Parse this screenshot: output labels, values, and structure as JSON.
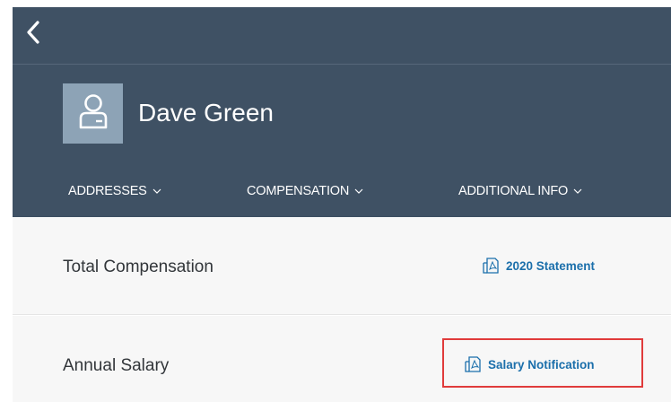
{
  "header": {
    "employee_name": "Dave Green",
    "background_color": "#3f5164",
    "tabs": [
      {
        "label": "ADDRESSES"
      },
      {
        "label": "COMPENSATION"
      },
      {
        "label": "ADDITIONAL INFO"
      }
    ]
  },
  "rows": [
    {
      "label": "Total Compensation",
      "link_label": "2020 Statement"
    },
    {
      "label": "Annual Salary",
      "link_label": "Salary Notification"
    }
  ],
  "colors": {
    "link": "#1b6fab",
    "highlight": "#e03b3b",
    "avatar_bg": "#8da3b6"
  },
  "icons": {
    "back": "chevron-left-icon",
    "avatar": "person-icon",
    "tab_dropdown": "chevron-down-icon",
    "document": "pdf-document-icon"
  }
}
